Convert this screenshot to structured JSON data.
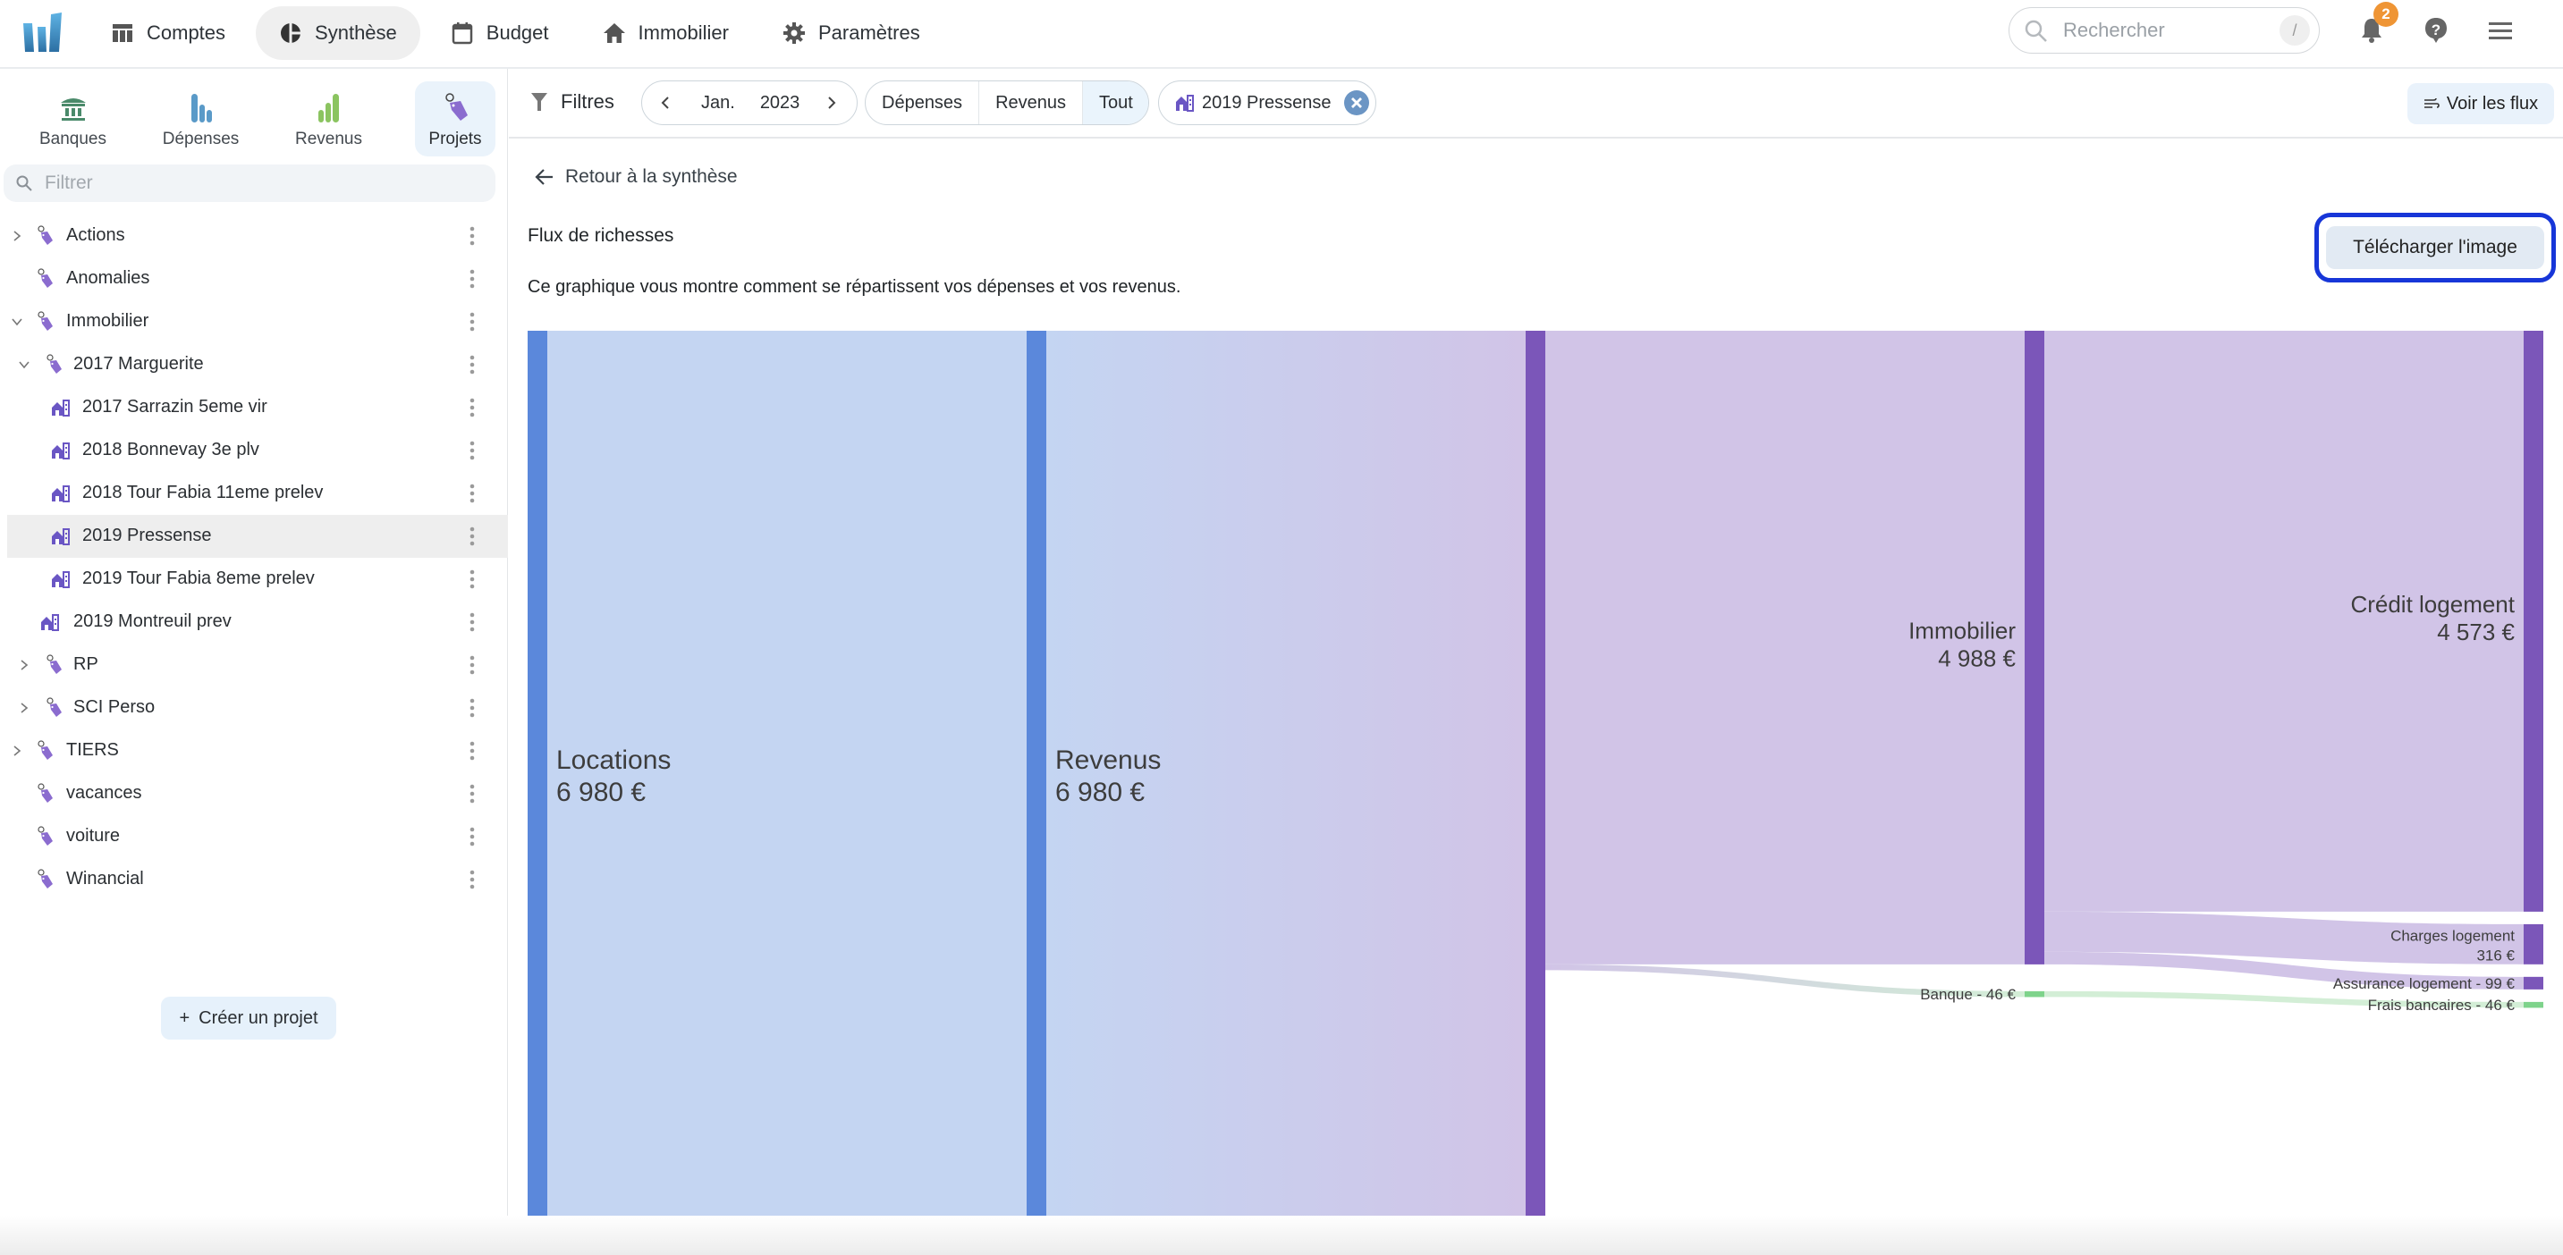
{
  "topnav": {
    "items": [
      {
        "label": "Comptes",
        "icon": "table-icon"
      },
      {
        "label": "Synthèse",
        "icon": "pie-chart-icon",
        "active": true
      },
      {
        "label": "Budget",
        "icon": "calendar-icon"
      },
      {
        "label": "Immobilier",
        "icon": "home-icon"
      },
      {
        "label": "Paramètres",
        "icon": "gear-icon"
      }
    ],
    "search_placeholder": "Rechercher",
    "search_shortcut": "/",
    "notification_count": "2"
  },
  "sidebar": {
    "tabs": [
      {
        "label": "Banques",
        "icon": "bank-icon"
      },
      {
        "label": "Dépenses",
        "icon": "expenses-bars-icon"
      },
      {
        "label": "Revenus",
        "icon": "revenue-bars-icon"
      },
      {
        "label": "Projets",
        "icon": "tag-icon",
        "active": true
      }
    ],
    "filter_placeholder": "Filtrer",
    "tree": [
      {
        "label": "Actions",
        "level": 0,
        "chevron": "right",
        "icon": "tag"
      },
      {
        "label": "Anomalies",
        "level": 0,
        "chevron": "",
        "icon": "tag"
      },
      {
        "label": "Immobilier",
        "level": 0,
        "chevron": "down",
        "icon": "tag"
      },
      {
        "label": "2017 Marguerite",
        "level": 1,
        "chevron": "down",
        "icon": "tag"
      },
      {
        "label": "2017 Sarrazin 5eme vir",
        "level": 2,
        "chevron": "",
        "icon": "building"
      },
      {
        "label": "2018 Bonnevay 3e plv",
        "level": 2,
        "chevron": "",
        "icon": "building"
      },
      {
        "label": "2018 Tour Fabia 11eme prelev",
        "level": 2,
        "chevron": "",
        "icon": "building"
      },
      {
        "label": "2019 Pressense",
        "level": 2,
        "chevron": "",
        "icon": "building",
        "selected": true
      },
      {
        "label": "2019 Tour Fabia 8eme prelev",
        "level": 2,
        "chevron": "",
        "icon": "building"
      },
      {
        "label": "2019 Montreuil prev",
        "level": 1,
        "chevron": "",
        "icon": "building"
      },
      {
        "label": "RP",
        "level": 1,
        "chevron": "right",
        "icon": "tag"
      },
      {
        "label": "SCI Perso",
        "level": 1,
        "chevron": "right",
        "icon": "tag"
      },
      {
        "label": "TIERS",
        "level": 0,
        "chevron": "right",
        "icon": "tag"
      },
      {
        "label": "vacances",
        "level": 0,
        "chevron": "",
        "icon": "tag"
      },
      {
        "label": "voiture",
        "level": 0,
        "chevron": "",
        "icon": "tag"
      },
      {
        "label": "Winancial",
        "level": 0,
        "chevron": "",
        "icon": "tag"
      }
    ],
    "create_label": "Créer un projet"
  },
  "filterbar": {
    "label": "Filtres",
    "month": "Jan.",
    "year": "2023",
    "types": [
      {
        "label": "Dépenses"
      },
      {
        "label": "Revenus"
      },
      {
        "label": "Tout",
        "active": true
      }
    ],
    "project_chip": "2019 Pressense",
    "voir_flux_label": "Voir les flux"
  },
  "main": {
    "back_label": "Retour à la synthèse",
    "title": "Flux de richesses",
    "description": "Ce graphique vous montre comment se répartissent vos dépenses et vos revenus.",
    "download_label": "Télécharger l'image"
  },
  "colors": {
    "revenue_node": "#5b88db",
    "expense_node": "#7b56b9",
    "bank_node": "#7ed38b",
    "revenue_link": "#c4d5f2",
    "expense_link": "#d1c4e7",
    "bank_link": "#d3eed6",
    "accent_outline": "#1736d8"
  },
  "chart_data": {
    "type": "sankey",
    "title": "Flux de richesses",
    "unit": "€",
    "nodes": [
      {
        "id": "locations",
        "label": "Locations",
        "value": 6980,
        "column": 0,
        "group": "revenue",
        "label_style": "big",
        "display": "6 980 €"
      },
      {
        "id": "revenus",
        "label": "Revenus",
        "value": 6980,
        "column": 1,
        "group": "revenue",
        "label_style": "big",
        "display": "6 980 €"
      },
      {
        "id": "depenses",
        "label": "",
        "value": 6980,
        "column": 2,
        "group": "expense",
        "label_style": "none",
        "display": ""
      },
      {
        "id": "immobilier",
        "label": "Immobilier",
        "value": 4988,
        "column": 3,
        "group": "expense",
        "label_style": "big-right",
        "display": "4 988 €"
      },
      {
        "id": "banque",
        "label": "Banque",
        "value": 46,
        "column": 3,
        "group": "bank",
        "label_style": "inline",
        "display": "46 €"
      },
      {
        "id": "credit",
        "label": "Crédit logement",
        "value": 4573,
        "column": 4,
        "group": "expense",
        "label_style": "big-right",
        "display": "4 573 €"
      },
      {
        "id": "charges",
        "label": "Charges logement",
        "value": 316,
        "column": 4,
        "group": "expense",
        "label_style": "small-two-line",
        "display": "316 €"
      },
      {
        "id": "assurance",
        "label": "Assurance logement",
        "value": 99,
        "column": 4,
        "group": "expense",
        "label_style": "inline",
        "display": "99 €"
      },
      {
        "id": "frais",
        "label": "Frais bancaires",
        "value": 46,
        "column": 4,
        "group": "bank",
        "label_style": "inline",
        "display": "46 €"
      }
    ],
    "links": [
      {
        "source": "locations",
        "target": "revenus",
        "value": 6980
      },
      {
        "source": "revenus",
        "target": "depenses",
        "value": 6980
      },
      {
        "source": "depenses",
        "target": "immobilier",
        "value": 4988
      },
      {
        "source": "depenses",
        "target": "banque",
        "value": 46
      },
      {
        "source": "immobilier",
        "target": "credit",
        "value": 4573
      },
      {
        "source": "immobilier",
        "target": "charges",
        "value": 316
      },
      {
        "source": "immobilier",
        "target": "assurance",
        "value": 99
      },
      {
        "source": "banque",
        "target": "frais",
        "value": 46
      }
    ]
  }
}
